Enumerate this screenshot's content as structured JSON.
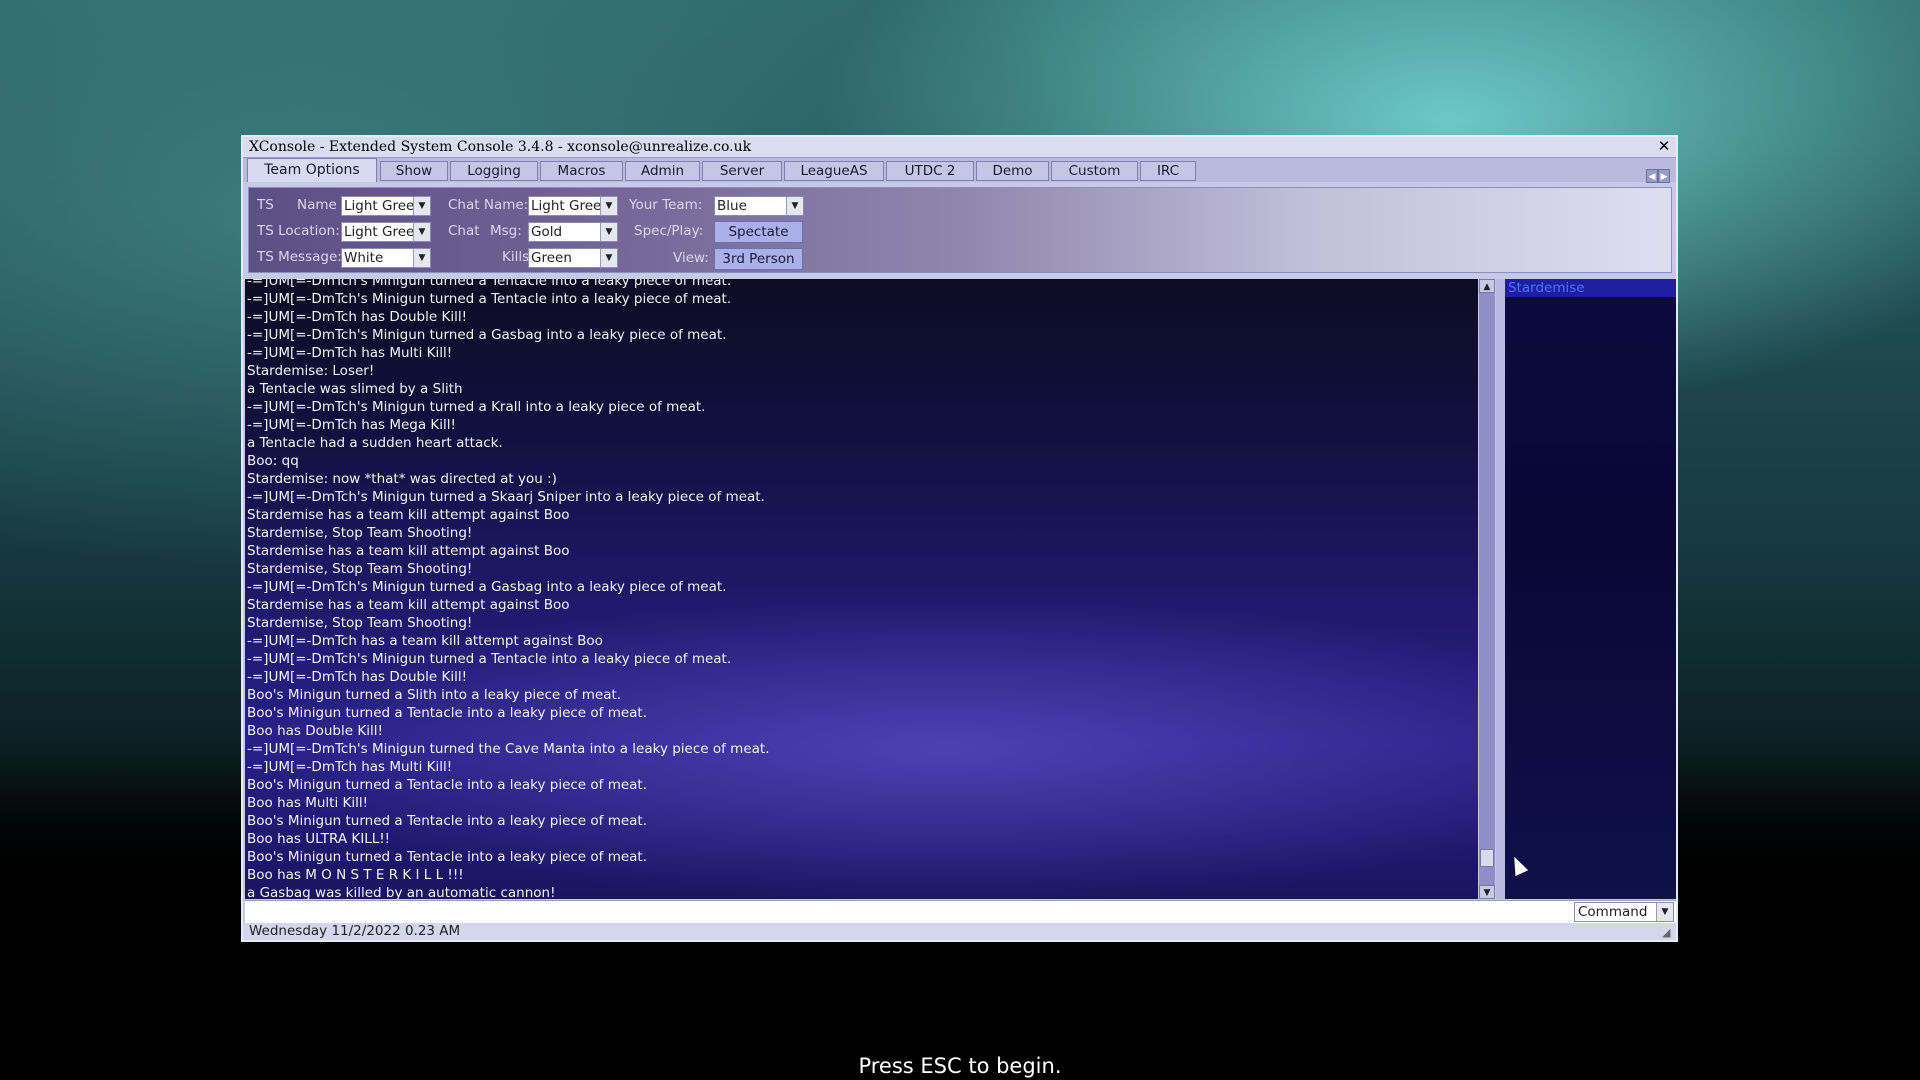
{
  "window": {
    "title": "XConsole - Extended System Console 3.4.8 - xconsole@unrealize.co.uk",
    "close_glyph": "✕"
  },
  "tabs": [
    "Team Options",
    "Show",
    "Logging",
    "Macros",
    "Admin",
    "Server",
    "LeagueAS",
    "UTDC 2",
    "Demo",
    "Custom",
    "IRC"
  ],
  "active_tab": "Team Options",
  "team_options": {
    "ts_label": "TS",
    "name_label": "Name",
    "name_value": "Light Green",
    "ts_location_label": "TS Location:",
    "ts_location_value": "Light Green",
    "ts_message_label": "TS Message:",
    "ts_message_value": "White",
    "chat_name_label": "Chat Name:",
    "chat_name_value": "Light Green",
    "chat_label": "Chat",
    "msg_label": "Msg:",
    "msg_value": "Gold",
    "kills_label": "Kills",
    "kills_value": "Green",
    "your_team_label": "Your Team:",
    "your_team_value": "Blue",
    "spec_play_label": "Spec/Play:",
    "spec_play_button": "Spectate",
    "view_label": "View:",
    "view_button": "3rd Person"
  },
  "log_lines": [
    "-=]UM[=-DmTch's Minigun turned a Tentacle into a leaky piece of meat.",
    "-=]UM[=-DmTch's Minigun turned a Tentacle into a leaky piece of meat.",
    "-=]UM[=-DmTch has Double Kill!",
    "-=]UM[=-DmTch's Minigun turned a Gasbag into a leaky piece of meat.",
    "-=]UM[=-DmTch has Multi Kill!",
    "Stardemise: Loser!",
    "a Tentacle was slimed by a Slith",
    "-=]UM[=-DmTch's Minigun turned a Krall into a leaky piece of meat.",
    "-=]UM[=-DmTch has Mega Kill!",
    "a Tentacle had a sudden heart attack.",
    "Boo: qq",
    "Stardemise: now *that* was directed at you :)",
    "-=]UM[=-DmTch's Minigun turned a Skaarj Sniper into a leaky piece of meat.",
    "Stardemise has a team kill attempt against Boo",
    "Stardemise, Stop Team Shooting!",
    "Stardemise has a team kill attempt against Boo",
    "Stardemise, Stop Team Shooting!",
    "-=]UM[=-DmTch's Minigun turned a Gasbag into a leaky piece of meat.",
    "Stardemise has a team kill attempt against Boo",
    "Stardemise, Stop Team Shooting!",
    "-=]UM[=-DmTch has a team kill attempt against Boo",
    "-=]UM[=-DmTch's Minigun turned a Tentacle into a leaky piece of meat.",
    "-=]UM[=-DmTch has Double Kill!",
    "Boo's Minigun turned a Slith into a leaky piece of meat.",
    "Boo's Minigun turned a Tentacle into a leaky piece of meat.",
    "Boo has Double Kill!",
    "-=]UM[=-DmTch's Minigun turned the Cave Manta into a leaky piece of meat.",
    "-=]UM[=-DmTch has Multi Kill!",
    "Boo's Minigun turned a Tentacle into a leaky piece of meat.",
    "Boo has Multi Kill!",
    "Boo's Minigun turned a Tentacle into a leaky piece of meat.",
    "Boo has ULTRA KILL!!",
    "Boo's Minigun turned a Tentacle into a leaky piece of meat.",
    "Boo has M O N S T E R  K I L L !!!",
    "a Gasbag was killed by an automatic cannon!"
  ],
  "user_list": [
    "Stardemise"
  ],
  "command": {
    "value": "",
    "mode": "Command"
  },
  "status": "Wednesday 11/2/2022 0.23 AM",
  "prompt": "Press ESC to begin."
}
